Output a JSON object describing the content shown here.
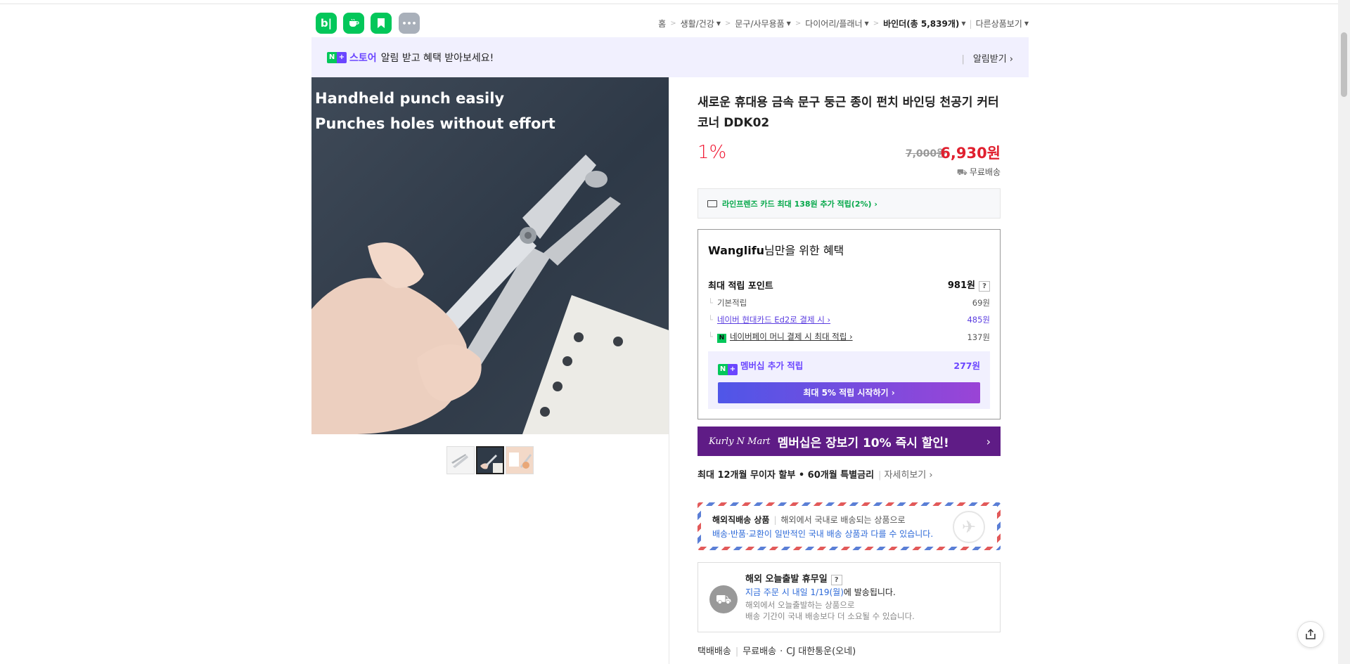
{
  "header": {
    "apps": [
      {
        "name": "blog-app",
        "glyph": "b|",
        "color": "#03c75a"
      },
      {
        "name": "cafe-app",
        "glyph": "☕",
        "color": "#03c75a"
      },
      {
        "name": "bookmark-app",
        "glyph": "🔖",
        "color": "#03c75a"
      },
      {
        "name": "more-apps",
        "glyph": "•••",
        "color": "#a9b0ba"
      }
    ],
    "breadcrumbs": [
      "홈",
      "생활/건강",
      "문구/사무용품",
      "다이어리/플래너",
      "바인더(총 5,839개)",
      "다른상품보기"
    ]
  },
  "banner": {
    "n_glyph": "N",
    "plus_glyph": "+",
    "store": "스토어",
    "message": "알림 받고 혜택 받아보세요!",
    "action": "알림받기 ›"
  },
  "image": {
    "caption_line1": "Handheld punch easily",
    "caption_line2": "Punches holes without effort"
  },
  "product": {
    "title": "새로운 휴대용 금속 문구 둥근 종이 펀치 바인딩 천공기 커터 코너 DDK02",
    "discount": "1%",
    "original_price": "7,000원",
    "price": "6,930원",
    "shipping": "무료배송",
    "card_offer": "라인프렌즈 카드 최대 138원 추가 적립(2%) ›"
  },
  "benefit": {
    "user": "Wanglifu",
    "title_rest": "님만을 위한 혜택",
    "max_points_label": "최대 적립 포인트",
    "max_points_value": "981원",
    "rows": [
      {
        "label": "기본적립",
        "value": "69원"
      },
      {
        "label": "네이버 현대카드 Ed2로 결제 시 ›",
        "value": "485원"
      },
      {
        "label": "네이버페이 머니 결제 시 최대 적립 ›",
        "value": "137원"
      }
    ],
    "membership_label": "멤버십 추가 적립",
    "membership_value": "277원",
    "membership_button": "최대 5% 적립 시작하기 ›"
  },
  "kurly": {
    "logo": "Kurly N Mart",
    "text": "멤버십은 장보기 10% 즉시 할인!",
    "chevron": "›"
  },
  "installment": {
    "text": "최대 12개월 무이자 할부 • 60개월 특별금리",
    "more": "자세히보기 ›"
  },
  "overseas": {
    "title": "해외직배송 상품",
    "desc": "해외에서 국내로 배송되는 상품으로",
    "note": "배송·반품·교환이 일반적인 국내 배송 상품과 다를 수 있습니다."
  },
  "dispatch": {
    "title": "해외 오늘출발 휴무일",
    "order_note_highlight": "지금 주문 시 내일 1/19(월)",
    "order_note_rest": "에 발송됩니다.",
    "gray_line1": "해외에서 오늘출발하는 상품으로",
    "gray_line2": "배송 기간이 국내 배송보다 더 소요될 수 있습니다."
  },
  "delivery": {
    "type": "택배배송",
    "fee": "무료배송",
    "carrier": "CJ 대한통운(오네)"
  },
  "colors": {
    "naver_green": "#03c75a",
    "price_red": "#e0202f",
    "purple": "#6b46ff",
    "kurly_purple": "#5f1c86"
  }
}
